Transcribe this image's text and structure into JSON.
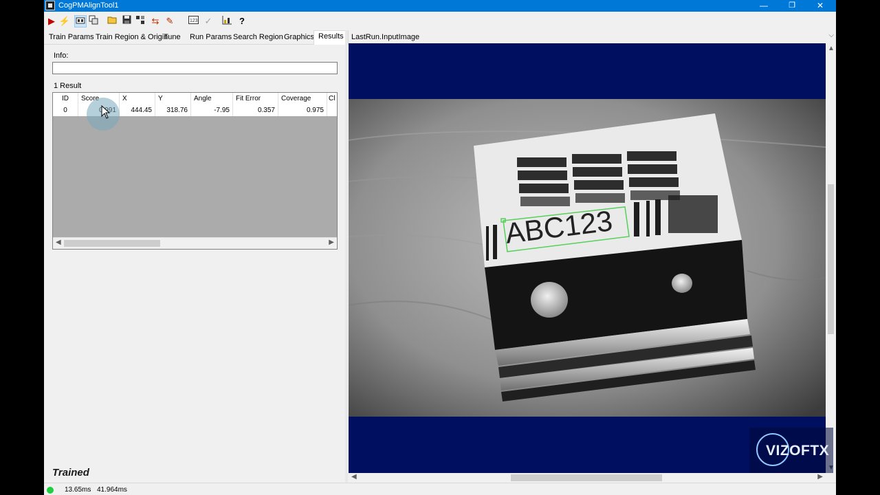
{
  "window": {
    "title": "CogPMAlignTool1",
    "controls": {
      "minimize": "—",
      "restore": "❐",
      "close": "✕"
    }
  },
  "toolbar": {
    "icons": [
      "run-icon",
      "train-icon",
      "display-icon",
      "copy-image-icon",
      "open-icon",
      "save-icon",
      "tools-icon",
      "reset-icon",
      "edit-icon",
      "numeric-icon",
      "check-icon",
      "chart-icon",
      "help-icon"
    ]
  },
  "tabs": [
    {
      "label": "Train Params"
    },
    {
      "label": "Train Region & Origin"
    },
    {
      "label": "Tune"
    },
    {
      "label": "Run Params"
    },
    {
      "label": "Search Region"
    },
    {
      "label": "Graphics"
    },
    {
      "label": "Results",
      "active": true
    }
  ],
  "results": {
    "info_label": "Info:",
    "info_value": "",
    "count_label": "1 Result",
    "columns": [
      "ID",
      "Score",
      "X",
      "Y",
      "Angle",
      "Fit Error",
      "Coverage",
      "Cl"
    ],
    "rows": [
      [
        "0",
        "0.991",
        "444.45",
        "318.76",
        "-7.95",
        "0.357",
        "0.975",
        ""
      ]
    ]
  },
  "status_text": "Trained",
  "image_panel": {
    "selector": "LastRun.InputImage",
    "part_text": "ABC123"
  },
  "statusbar": {
    "time1": "13.65ms",
    "time2": "41.964ms",
    "led_color": "#1fcf3f"
  },
  "watermark": "VIZOFTX",
  "colors": {
    "titlebar": "#0078d7",
    "display_background": "#000f5f",
    "grid_background": "#ababab"
  }
}
